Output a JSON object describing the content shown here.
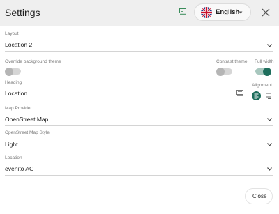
{
  "header": {
    "title": "Settings",
    "language": "English"
  },
  "fields": {
    "layout": {
      "label": "Layout",
      "value": "Location 2"
    },
    "override_bg": {
      "label": "Override background theme",
      "enabled": false
    },
    "contrast_theme": {
      "label": "Contrast theme",
      "enabled": false
    },
    "full_width": {
      "label": "Full width",
      "enabled": true
    },
    "heading": {
      "label": "Heading",
      "value": "Location"
    },
    "alignment": {
      "label": "Alignment",
      "selected": "left"
    },
    "map_provider": {
      "label": "Map Provider",
      "value": "OpenStreet Map"
    },
    "map_style": {
      "label": "OpenStreet Map Style",
      "value": "Light"
    },
    "location": {
      "label": "Location",
      "value": "evenito AG"
    }
  },
  "footer": {
    "close_label": "Close"
  },
  "colors": {
    "accent": "#1e6e5c",
    "header_bg": "#efefef"
  }
}
